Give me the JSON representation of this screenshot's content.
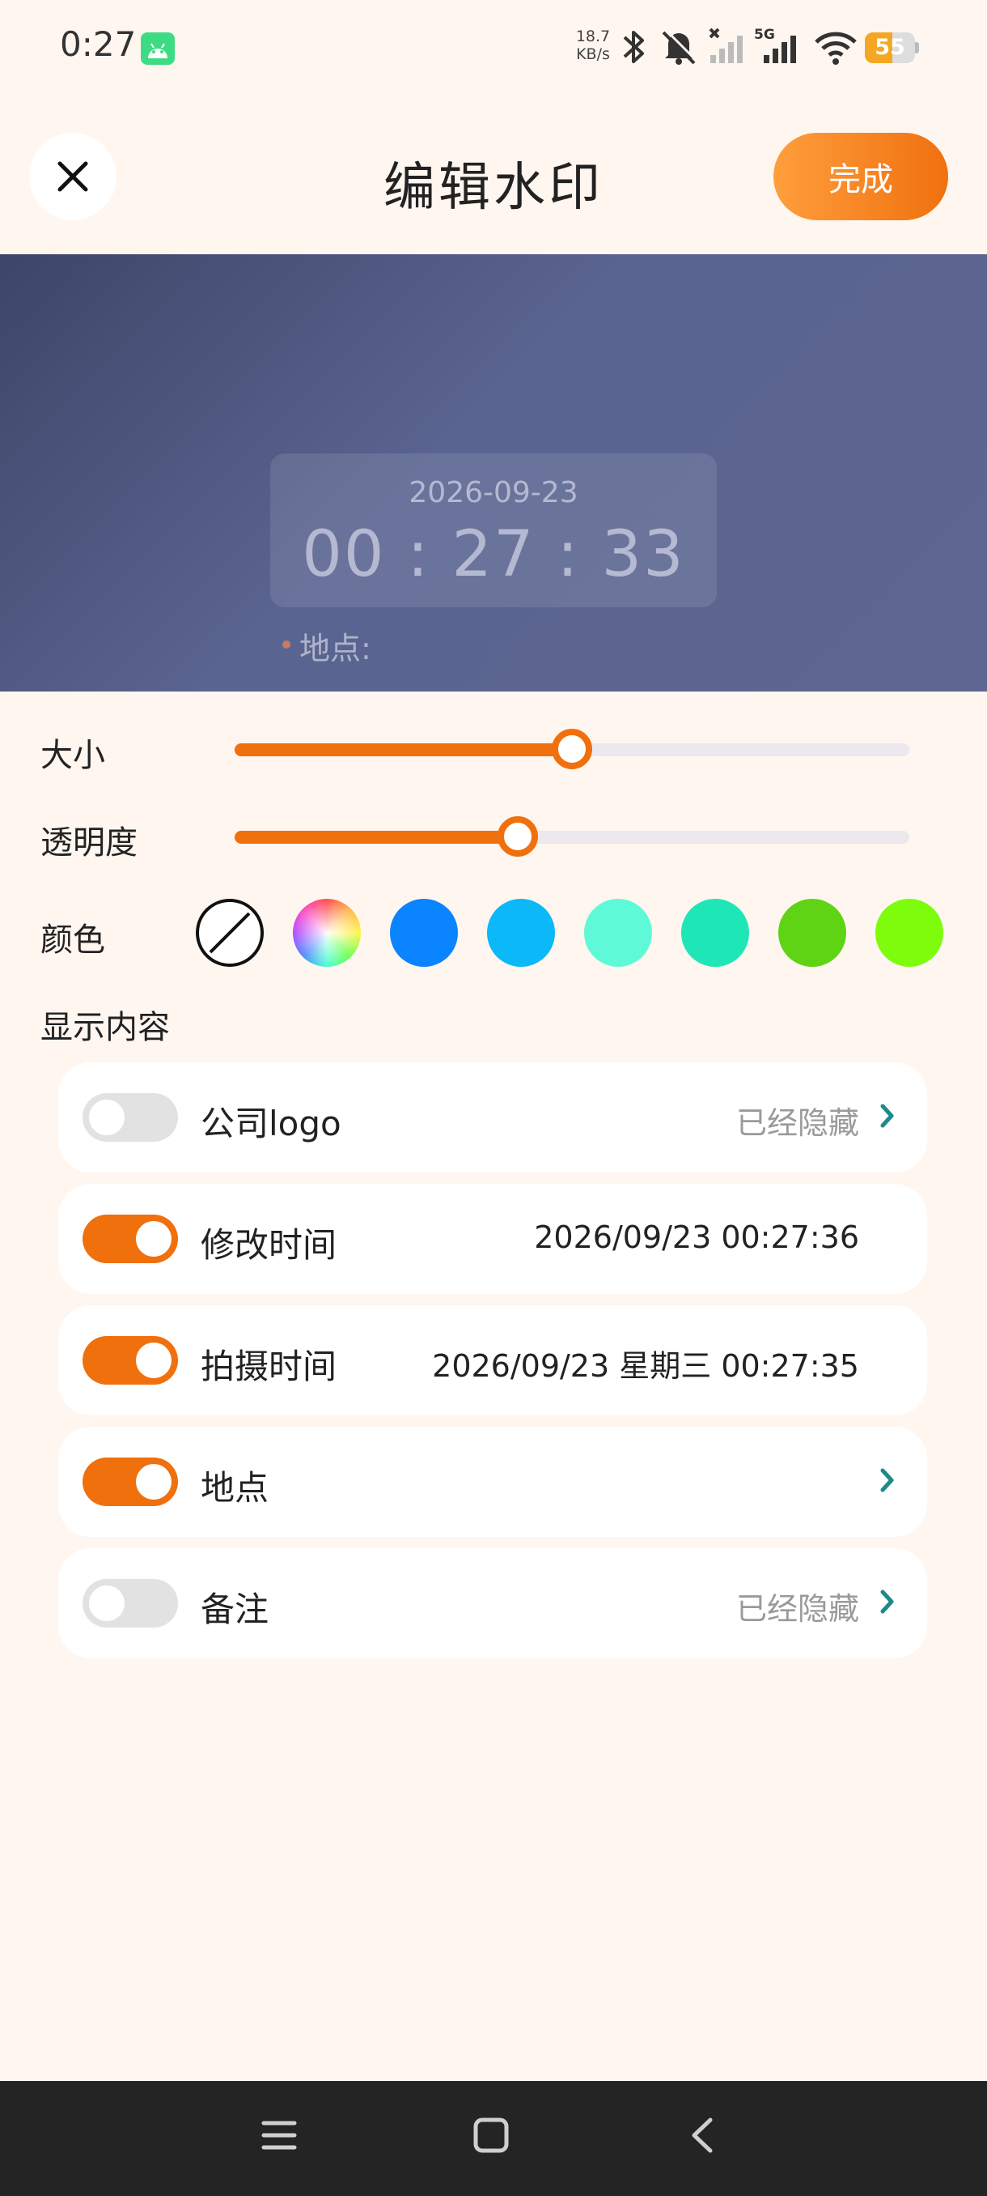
{
  "status_bar": {
    "time": "0:27",
    "net_speed_value": "18.7",
    "net_speed_unit": "KB/s",
    "network_type": "5G",
    "battery_level": "55",
    "battery_fraction": 0.55
  },
  "header": {
    "title": "编辑水印",
    "done_label": "完成"
  },
  "preview": {
    "date": "2026-09-23",
    "time": "00 : 27 : 33",
    "location_label": "地点:"
  },
  "sliders": [
    {
      "label": "大小",
      "value_fraction": 0.5
    },
    {
      "label": "透明度",
      "value_fraction": 0.42
    }
  ],
  "colors": {
    "label": "颜色",
    "swatches": [
      "none",
      "rainbow",
      "#0A84FF",
      "#0BB8F8",
      "#5EFAD7",
      "#1FE6B7",
      "#5ED414",
      "#7DFC0C"
    ]
  },
  "display_content": {
    "title": "显示内容",
    "items": [
      {
        "label": "公司logo",
        "enabled": false,
        "value": "已经隐藏",
        "has_chevron": true
      },
      {
        "label": "修改时间",
        "enabled": true,
        "value": "2026/09/23 00:27:36",
        "has_chevron": false
      },
      {
        "label": "拍摄时间",
        "enabled": true,
        "value": "2026/09/23 星期三 00:27:35",
        "has_chevron": false
      },
      {
        "label": "地点",
        "enabled": true,
        "value": "",
        "has_chevron": true
      },
      {
        "label": "备注",
        "enabled": false,
        "value": "已经隐藏",
        "has_chevron": true
      }
    ]
  },
  "theme": {
    "accent": "#F0700E",
    "chevron_color": "#1E8A8A"
  }
}
